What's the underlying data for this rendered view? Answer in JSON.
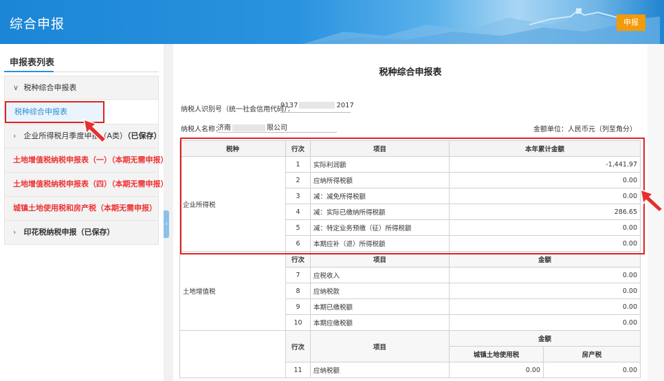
{
  "header": {
    "title": "综合申报",
    "submit_label": "申报"
  },
  "sidebar": {
    "title": "申报表列表",
    "items": [
      {
        "label": "税种综合申报表",
        "chev": "∨"
      },
      {
        "label": "税种综合申报表"
      },
      {
        "label": "企业所得税月季度申报（A类）",
        "status": "（已保存）",
        "chev": "›"
      },
      {
        "label": "土地增值税纳税申报表（一）（本期无需申报）"
      },
      {
        "label": "土地增值税纳税申报表（四）（本期无需申报）"
      },
      {
        "label": "城镇土地使用税和房产税（本期无需申报）"
      },
      {
        "label": "印花税纳税申报（已保存）",
        "chev": "›"
      }
    ],
    "collapse_icon": "‹"
  },
  "form": {
    "title": "税种综合申报表",
    "taxpayer_id_label": "纳税人识别号（统一社会信用代码）：",
    "taxpayer_id_prefix": "9137",
    "taxpayer_id_suffix": "2017",
    "taxpayer_name_label": "纳税人名称：",
    "taxpayer_name_prefix": "济南",
    "taxpayer_name_suffix": "限公司",
    "unit": "金额单位：人民币元（列至角分）"
  },
  "table": {
    "headers": {
      "tax_type": "税种",
      "row_no": "行次",
      "item": "项目",
      "cumulative": "本年累计金额",
      "amount": "金额",
      "land_use": "城镇土地使用税",
      "property": "房产税"
    },
    "section1": {
      "tax_type": "企业所得税",
      "rows": [
        {
          "no": "1",
          "item": "实际利润额",
          "value": "-1,441.97"
        },
        {
          "no": "2",
          "item": "应纳所得税额",
          "value": "0.00"
        },
        {
          "no": "3",
          "item": "减：减免所得税额",
          "value": "0.00"
        },
        {
          "no": "4",
          "item": "减：实际已缴纳所得税额",
          "value": "286.65"
        },
        {
          "no": "5",
          "item": "减：特定业务预缴（征）所得税额",
          "value": "0.00"
        },
        {
          "no": "6",
          "item": "本期应补（退）所得税额",
          "value": "0.00"
        }
      ]
    },
    "section2": {
      "tax_type": "土地增值税",
      "rows": [
        {
          "no": "7",
          "item": "应税收入",
          "value": "0.00"
        },
        {
          "no": "8",
          "item": "应纳税款",
          "value": "0.00"
        },
        {
          "no": "9",
          "item": "本期已缴税额",
          "value": "0.00"
        },
        {
          "no": "10",
          "item": "本期应缴税额",
          "value": "0.00"
        }
      ]
    },
    "section3": {
      "rows": [
        {
          "no": "11",
          "item": "应纳税额",
          "land_use": "0.00",
          "property": "0.00"
        }
      ]
    }
  }
}
